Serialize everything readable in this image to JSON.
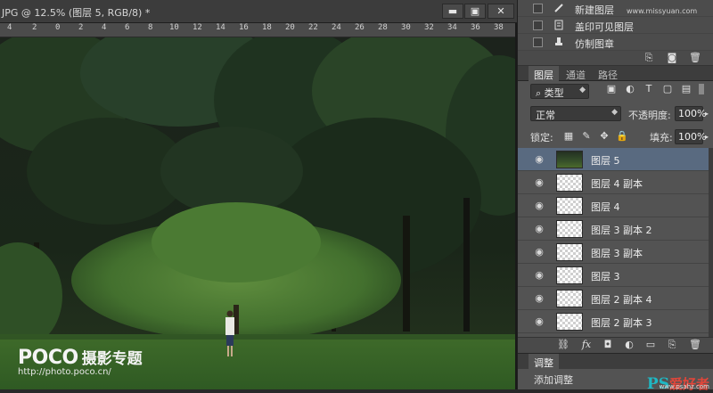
{
  "document": {
    "title": "JPG @ 12.5% (图层 5, RGB/8) *",
    "window_buttons": [
      "▬",
      "▣",
      "✕"
    ],
    "ruler_ticks": [
      "4",
      "2",
      "0",
      "2",
      "4",
      "6",
      "8",
      "10",
      "12",
      "14",
      "16",
      "18",
      "20",
      "22",
      "24",
      "26",
      "28",
      "30",
      "32",
      "34",
      "36",
      "38"
    ],
    "watermark": {
      "brand": "POCO",
      "brand_cn": "摄影专题",
      "url": "http://photo.poco.cn/"
    }
  },
  "history": {
    "items": [
      {
        "label": "新建图层",
        "icon": "brush-icon"
      },
      {
        "label": "盖印可见图层",
        "icon": "document-icon"
      },
      {
        "label": "仿制图章",
        "icon": "stamp-icon"
      }
    ],
    "top_watermark": "www.missyuan.com"
  },
  "layers_panel": {
    "tabs": [
      "图层",
      "通道",
      "路径"
    ],
    "active_tab": "图层",
    "filter_kind": "类型",
    "blend_mode": "正常",
    "opacity_label": "不透明度:",
    "opacity_value": "100%",
    "lock_label": "锁定:",
    "fill_label": "填充:",
    "fill_value": "100%",
    "layers": [
      {
        "name": "图层 5",
        "selected": true,
        "thumb": "photo"
      },
      {
        "name": "图层 4 副本",
        "selected": false,
        "thumb": "transparent"
      },
      {
        "name": "图层 4",
        "selected": false,
        "thumb": "transparent"
      },
      {
        "name": "图层 3 副本 2",
        "selected": false,
        "thumb": "transparent"
      },
      {
        "name": "图层 3 副本",
        "selected": false,
        "thumb": "transparent"
      },
      {
        "name": "图层 3",
        "selected": false,
        "thumb": "transparent"
      },
      {
        "name": "图层 2 副本 4",
        "selected": false,
        "thumb": "transparent"
      },
      {
        "name": "图层 2 副本 3",
        "selected": false,
        "thumb": "transparent"
      }
    ]
  },
  "adjustments": {
    "tab": "调整",
    "body_label": "添加调整"
  },
  "site_mark": {
    "ps": "PS",
    "cn": "爱好者",
    "url": "www.psahz.com"
  },
  "colors": {
    "selection": "#596a80",
    "panel": "#535353",
    "site_ps": "#1fb8c4",
    "site_cn": "#e2463a"
  }
}
